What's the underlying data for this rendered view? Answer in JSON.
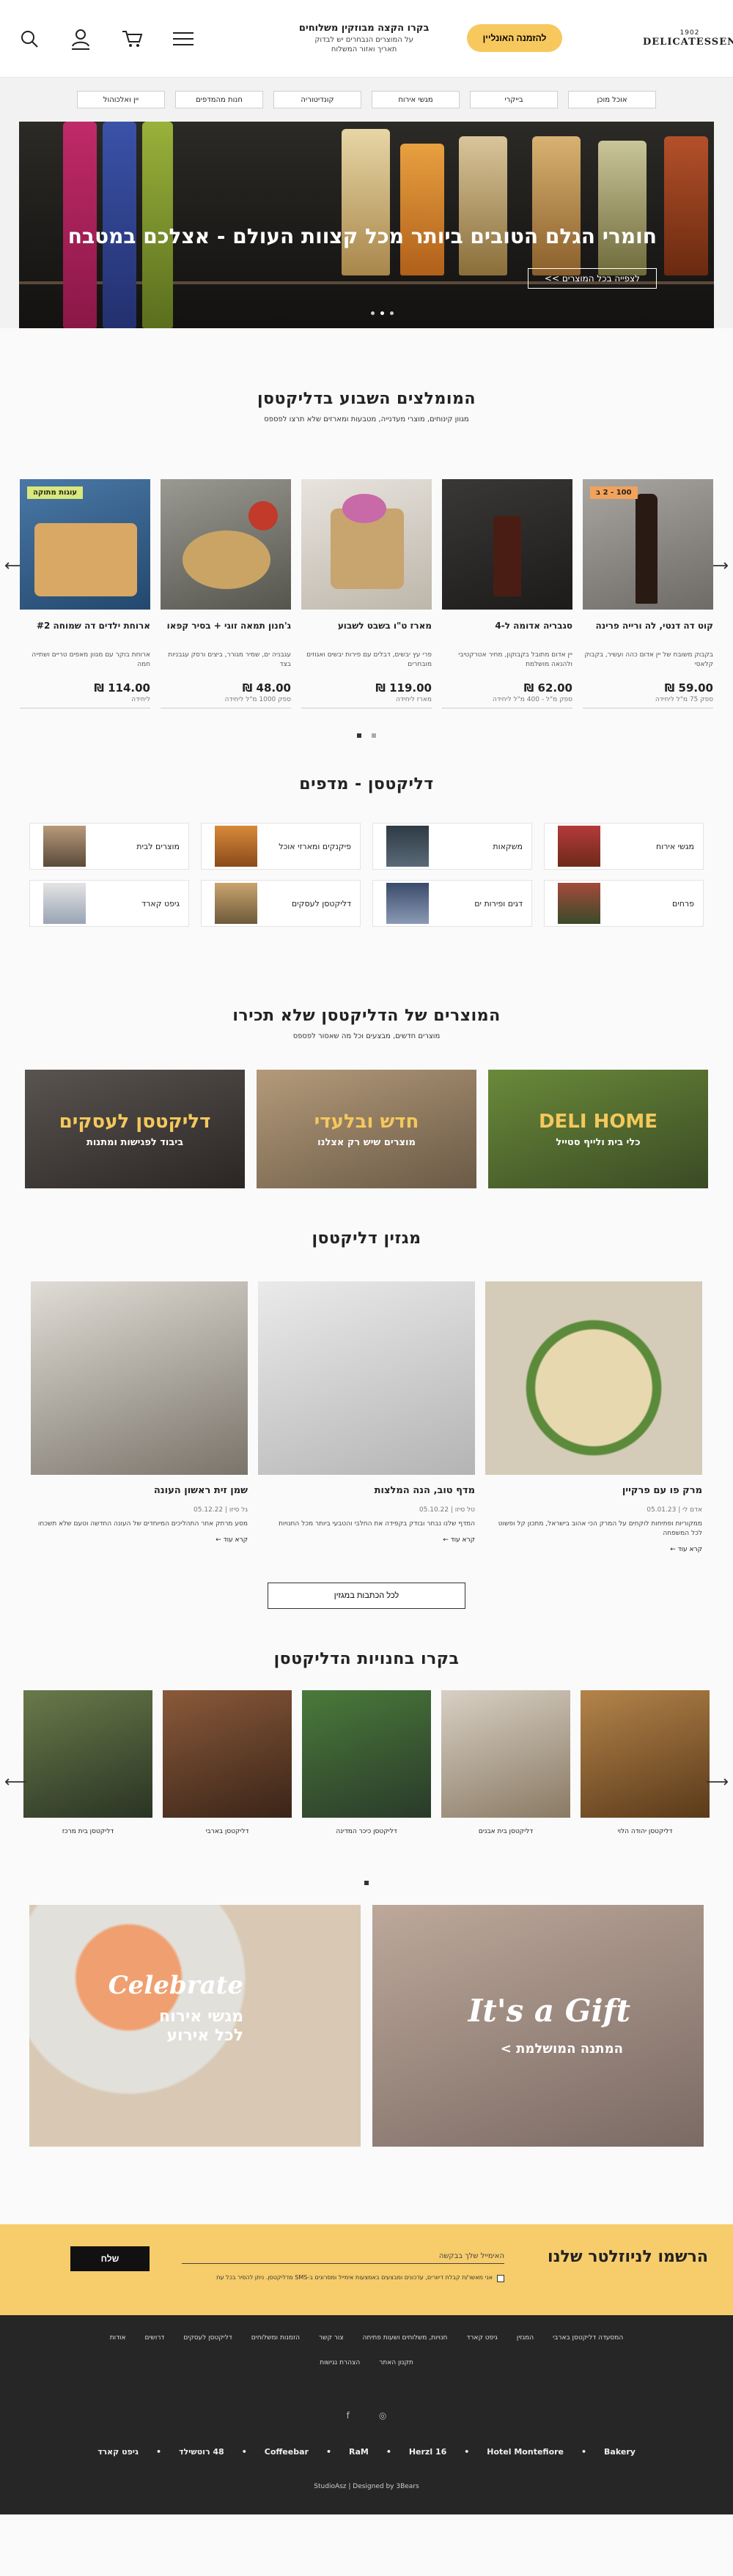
{
  "header": {
    "logo_mark": "1902",
    "logo_word": "DELICATESSEN",
    "order_label": "להזמנה האונליין",
    "delivery_title": "בקרו הקצה מבוזקין משלוחים",
    "delivery_sub_1": "על המוצרים הנבחרים יש לבדוק",
    "delivery_sub_2": "תאריך ואזור המשלוח"
  },
  "catnav": [
    "אוכל מוכן",
    "בייקרי",
    "מגשי אירוח",
    "קונדיטוריה",
    "חנות מהמדפים",
    "יין ואלכוהול"
  ],
  "hero": {
    "title": "חומרי הגלם הטובים ביותר מכל קצוות העולם - אצלכם במטבח",
    "cta": "לצפייה בכל המוצרים >>"
  },
  "weekly": {
    "title": "המומלצים השבוע בדליקטסן",
    "subtitle": "מגוון קינוחים, מוצרי מעדנייה, מטבעות ומארזים שלא תרצו לפספס",
    "products": [
      {
        "badge": "100 - 2 ב",
        "name": "קוט דה דנטי, לה ורייה פרינה",
        "desc": "בקבוק משובח של יין אדום כהה ועשיר, בקבוק קלאסי",
        "price": "59.00 ₪",
        "unit": "ספק 75 מ\"ל ליחידה"
      },
      {
        "badge": "",
        "name": "סגבריה אדומה ל-4",
        "desc": "יין אדום מתובל בקבוקון, מחיר אטרקטיבי ולהנאה מושלמת",
        "price": "62.00 ₪",
        "unit": "ספק מ\"ל - 400 מ\"ל ליחידה"
      },
      {
        "badge": "",
        "name": "מארז ט\"ו בשבט לשבוע",
        "desc": "פרי עץ יבשים, דבלים עם פירות יבשים ואגוזים מובחרים",
        "price": "119.00 ₪",
        "unit": "מארז ליחידה"
      },
      {
        "badge": "",
        "name": "ג'חנון תמאה זוגי + בסיר קפאו",
        "desc": "עגבניה ים, שמיר מגורר, ביצים ורסק עגבניות בצד",
        "price": "48.00 ₪",
        "unit": "ספק 1000 מ\"ל ליחידה"
      },
      {
        "badge": "עוגות מתוקה",
        "name": "ארוחת ילדים דה שמוחה #2",
        "desc": "ארוחת בוקר עם מגוון מאפים טריים ושתייה חמה",
        "price": "114.00 ₪",
        "unit": "ליחידה"
      }
    ]
  },
  "catgrid": {
    "title": "דליקטסן - מדפים",
    "items": [
      "מגשי אירוח",
      "משקאות",
      "פיקנקים ומארזי אוכל",
      "מוצרים לבית",
      "פרחים",
      "דגים ופירות ים",
      "דליקטסן לעסקים",
      "גיפט קארד"
    ]
  },
  "promos": {
    "title": "המוצרים של הדליקטסן שלא תכירו",
    "subtitle": "מוצרים חדשים, מבצעים וכל מה שאסור לפספס",
    "banners": [
      {
        "big": "DELI HOME",
        "small": "כלי בית ולייף סטייל"
      },
      {
        "big": "חדש ובלעדי",
        "small": "מוצרים שיש רק אצלנו"
      },
      {
        "big": "דליקטסן לעסקים",
        "small": "ביבוד לפגישות ומתנות"
      }
    ]
  },
  "magazine": {
    "title": "מגזין דליקטסן",
    "posts": [
      {
        "title": "מרק פו עם פרקיין",
        "meta": "אדם לי | 05.01.23",
        "excerpt": "ממקוריות ופתיחות לוקחים על המרק הכי אהוב בישראל, מתכון קל ופשוט לכל המשפחה",
        "more": "קרא עוד ←"
      },
      {
        "title": "מדף טוב, הנה המלצות",
        "meta": "טל סיזו | 05.10.22",
        "excerpt": "המדף שלנו נבחר ובודק בקפידה את החלבי והטבעי ביותר מכל החנויות",
        "more": "קרא עוד ←"
      },
      {
        "title": "שמן זית ראשון העונה",
        "meta": "גל סיזו | 05.12.22",
        "excerpt": "מסע מרתק אחר התהליכים המיוחדים של העונה החדשה וטעם שלא תשכחו",
        "more": "קרא עוד ←"
      }
    ],
    "all_label": "לכל הכתבות במגזין"
  },
  "stores": {
    "title": "בקרו בחנויות הדליקטסן",
    "items": [
      "דליקטסן יהודה הלוי",
      "דליקטסן בית אבנים",
      "דליקטסן כיכר המדינה",
      "דליקטסן בארבי",
      "דליקטסן בית מרכז"
    ]
  },
  "bigbanners": [
    {
      "t1": "It's a Gift",
      "t2": "המתנה המושלמת >"
    },
    {
      "t1": "Celebrate",
      "t2": "מגשי אירוח לכל אירוע"
    }
  ],
  "newsletter": {
    "title": "הרשמו לניוזלטר שלנו",
    "placeholder": "האימייל שלך בבקשה",
    "send": "שלח",
    "consent": "אני מאשר/ת קבלת דיוורים, עדכונים ומבצעים באמצעות אימייל ומסרונים ב-SMS מדליקטסן. ניתן להסיר בכל עת"
  },
  "footer": {
    "nav1": [
      "אודות",
      "דרושים",
      "דליקטסן לעסקים",
      "הזמנות ומשלוחים",
      "צור קשר",
      "חנויות, משלוחים ושעות פתיחה",
      "גיפט קארד",
      "המגזין",
      "המסעדה דליקטסן בארבי"
    ],
    "nav2": [
      "תקנון האתר",
      "הצהרת נגישות"
    ],
    "social": [
      "f",
      "◎"
    ],
    "brands": [
      "Bakery",
      "Hotel Montefiore",
      "Herzl 16",
      "RaM",
      "Coffeebar",
      "48 רוטשילד",
      "גיפט קארד"
    ],
    "credit": "StudioAsz | Designed by 3Bears"
  },
  "colors": {
    "accent": "#f7c85e",
    "dark": "#262626",
    "newsletter": "#f7cc6a"
  }
}
